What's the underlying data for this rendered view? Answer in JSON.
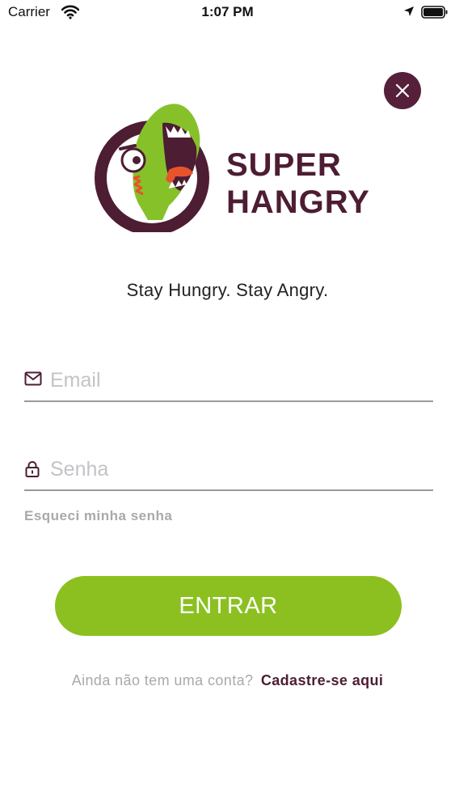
{
  "status_bar": {
    "carrier": "Carrier",
    "time": "1:07 PM",
    "icons": [
      "wifi-icon",
      "location-arrow-icon",
      "battery-icon"
    ]
  },
  "close_button": {
    "icon": "close-icon"
  },
  "logo": {
    "line1": "SUPER",
    "line2": "HANGRY"
  },
  "tagline": "Stay Hungry. Stay Angry.",
  "form": {
    "email": {
      "placeholder": "Email",
      "value": "",
      "icon": "envelope-icon"
    },
    "password": {
      "placeholder": "Senha",
      "value": "",
      "icon": "lock-icon"
    },
    "forgot_password": "Esqueci minha senha",
    "submit_label": "ENTRAR"
  },
  "signup": {
    "prompt": "Ainda não tem uma conta?",
    "link": "Cadastre-se aqui"
  },
  "colors": {
    "brand_dark": "#56203a",
    "brand_green": "#8cc021",
    "muted_text": "#a9a9a9"
  }
}
